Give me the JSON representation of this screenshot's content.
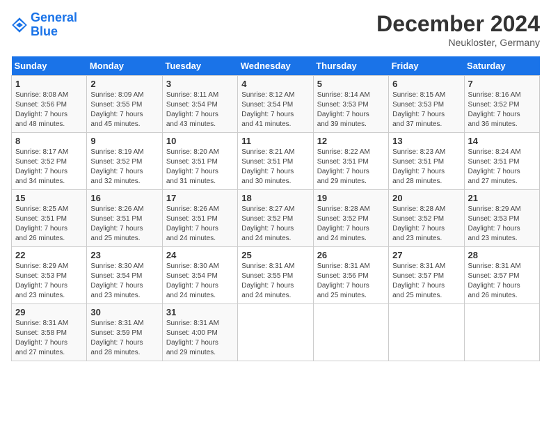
{
  "header": {
    "logo_line1": "General",
    "logo_line2": "Blue",
    "month": "December 2024",
    "location": "Neukloster, Germany"
  },
  "days_of_week": [
    "Sunday",
    "Monday",
    "Tuesday",
    "Wednesday",
    "Thursday",
    "Friday",
    "Saturday"
  ],
  "weeks": [
    [
      {
        "day": "1",
        "info": "Sunrise: 8:08 AM\nSunset: 3:56 PM\nDaylight: 7 hours\nand 48 minutes."
      },
      {
        "day": "2",
        "info": "Sunrise: 8:09 AM\nSunset: 3:55 PM\nDaylight: 7 hours\nand 45 minutes."
      },
      {
        "day": "3",
        "info": "Sunrise: 8:11 AM\nSunset: 3:54 PM\nDaylight: 7 hours\nand 43 minutes."
      },
      {
        "day": "4",
        "info": "Sunrise: 8:12 AM\nSunset: 3:54 PM\nDaylight: 7 hours\nand 41 minutes."
      },
      {
        "day": "5",
        "info": "Sunrise: 8:14 AM\nSunset: 3:53 PM\nDaylight: 7 hours\nand 39 minutes."
      },
      {
        "day": "6",
        "info": "Sunrise: 8:15 AM\nSunset: 3:53 PM\nDaylight: 7 hours\nand 37 minutes."
      },
      {
        "day": "7",
        "info": "Sunrise: 8:16 AM\nSunset: 3:52 PM\nDaylight: 7 hours\nand 36 minutes."
      }
    ],
    [
      {
        "day": "8",
        "info": "Sunrise: 8:17 AM\nSunset: 3:52 PM\nDaylight: 7 hours\nand 34 minutes."
      },
      {
        "day": "9",
        "info": "Sunrise: 8:19 AM\nSunset: 3:52 PM\nDaylight: 7 hours\nand 32 minutes."
      },
      {
        "day": "10",
        "info": "Sunrise: 8:20 AM\nSunset: 3:51 PM\nDaylight: 7 hours\nand 31 minutes."
      },
      {
        "day": "11",
        "info": "Sunrise: 8:21 AM\nSunset: 3:51 PM\nDaylight: 7 hours\nand 30 minutes."
      },
      {
        "day": "12",
        "info": "Sunrise: 8:22 AM\nSunset: 3:51 PM\nDaylight: 7 hours\nand 29 minutes."
      },
      {
        "day": "13",
        "info": "Sunrise: 8:23 AM\nSunset: 3:51 PM\nDaylight: 7 hours\nand 28 minutes."
      },
      {
        "day": "14",
        "info": "Sunrise: 8:24 AM\nSunset: 3:51 PM\nDaylight: 7 hours\nand 27 minutes."
      }
    ],
    [
      {
        "day": "15",
        "info": "Sunrise: 8:25 AM\nSunset: 3:51 PM\nDaylight: 7 hours\nand 26 minutes."
      },
      {
        "day": "16",
        "info": "Sunrise: 8:26 AM\nSunset: 3:51 PM\nDaylight: 7 hours\nand 25 minutes."
      },
      {
        "day": "17",
        "info": "Sunrise: 8:26 AM\nSunset: 3:51 PM\nDaylight: 7 hours\nand 24 minutes."
      },
      {
        "day": "18",
        "info": "Sunrise: 8:27 AM\nSunset: 3:52 PM\nDaylight: 7 hours\nand 24 minutes."
      },
      {
        "day": "19",
        "info": "Sunrise: 8:28 AM\nSunset: 3:52 PM\nDaylight: 7 hours\nand 24 minutes."
      },
      {
        "day": "20",
        "info": "Sunrise: 8:28 AM\nSunset: 3:52 PM\nDaylight: 7 hours\nand 23 minutes."
      },
      {
        "day": "21",
        "info": "Sunrise: 8:29 AM\nSunset: 3:53 PM\nDaylight: 7 hours\nand 23 minutes."
      }
    ],
    [
      {
        "day": "22",
        "info": "Sunrise: 8:29 AM\nSunset: 3:53 PM\nDaylight: 7 hours\nand 23 minutes."
      },
      {
        "day": "23",
        "info": "Sunrise: 8:30 AM\nSunset: 3:54 PM\nDaylight: 7 hours\nand 23 minutes."
      },
      {
        "day": "24",
        "info": "Sunrise: 8:30 AM\nSunset: 3:54 PM\nDaylight: 7 hours\nand 24 minutes."
      },
      {
        "day": "25",
        "info": "Sunrise: 8:31 AM\nSunset: 3:55 PM\nDaylight: 7 hours\nand 24 minutes."
      },
      {
        "day": "26",
        "info": "Sunrise: 8:31 AM\nSunset: 3:56 PM\nDaylight: 7 hours\nand 25 minutes."
      },
      {
        "day": "27",
        "info": "Sunrise: 8:31 AM\nSunset: 3:57 PM\nDaylight: 7 hours\nand 25 minutes."
      },
      {
        "day": "28",
        "info": "Sunrise: 8:31 AM\nSunset: 3:57 PM\nDaylight: 7 hours\nand 26 minutes."
      }
    ],
    [
      {
        "day": "29",
        "info": "Sunrise: 8:31 AM\nSunset: 3:58 PM\nDaylight: 7 hours\nand 27 minutes."
      },
      {
        "day": "30",
        "info": "Sunrise: 8:31 AM\nSunset: 3:59 PM\nDaylight: 7 hours\nand 28 minutes."
      },
      {
        "day": "31",
        "info": "Sunrise: 8:31 AM\nSunset: 4:00 PM\nDaylight: 7 hours\nand 29 minutes."
      },
      null,
      null,
      null,
      null
    ]
  ]
}
